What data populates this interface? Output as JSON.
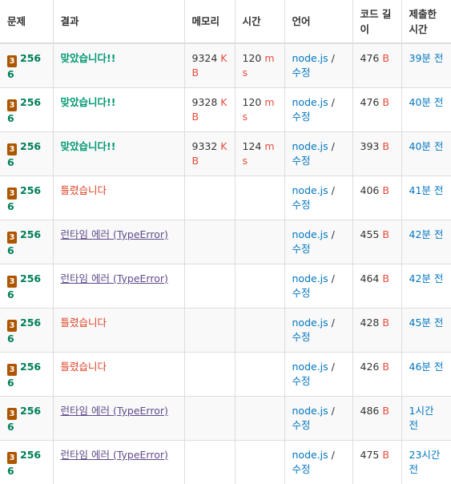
{
  "headers": {
    "problem": "문제",
    "result": "결과",
    "memory": "메모리",
    "time": "시간",
    "language": "언어",
    "code_length": "코드 길이",
    "submitted": "제출한 시간"
  },
  "tier_icon": "3",
  "rows": [
    {
      "problem": "2566",
      "result": "맞았습니다!!",
      "result_type": "ok",
      "memory": "9324",
      "memory_unit": "KB",
      "time": "120",
      "time_unit": "ms",
      "lang": "node.js",
      "sep": " / ",
      "edit": "수정",
      "code_len": "476",
      "len_unit": "B",
      "submitted": "39분 전"
    },
    {
      "problem": "2566",
      "result": "맞았습니다!!",
      "result_type": "ok",
      "memory": "9328",
      "memory_unit": "KB",
      "time": "120",
      "time_unit": "ms",
      "lang": "node.js",
      "sep": " / ",
      "edit": "수정",
      "code_len": "476",
      "len_unit": "B",
      "submitted": "40분 전"
    },
    {
      "problem": "2566",
      "result": "맞았습니다!!",
      "result_type": "ok",
      "memory": "9332",
      "memory_unit": "KB",
      "time": "124",
      "time_unit": "ms",
      "lang": "node.js",
      "sep": " / ",
      "edit": "수정",
      "code_len": "393",
      "len_unit": "B",
      "submitted": "40분 전"
    },
    {
      "problem": "2566",
      "result": "틀렸습니다",
      "result_type": "wrong",
      "memory": "",
      "memory_unit": "",
      "time": "",
      "time_unit": "",
      "lang": "node.js",
      "sep": " / ",
      "edit": "수정",
      "code_len": "406",
      "len_unit": "B",
      "submitted": "41분 전"
    },
    {
      "problem": "2566",
      "result": "런타임 에러 (TypeError)",
      "result_type": "rte",
      "memory": "",
      "memory_unit": "",
      "time": "",
      "time_unit": "",
      "lang": "node.js",
      "sep": " / ",
      "edit": "수정",
      "code_len": "455",
      "len_unit": "B",
      "submitted": "42분 전"
    },
    {
      "problem": "2566",
      "result": "런타임 에러 (TypeError)",
      "result_type": "rte",
      "memory": "",
      "memory_unit": "",
      "time": "",
      "time_unit": "",
      "lang": "node.js",
      "sep": " / ",
      "edit": "수정",
      "code_len": "464",
      "len_unit": "B",
      "submitted": "42분 전"
    },
    {
      "problem": "2566",
      "result": "틀렸습니다",
      "result_type": "wrong",
      "memory": "",
      "memory_unit": "",
      "time": "",
      "time_unit": "",
      "lang": "node.js",
      "sep": " / ",
      "edit": "수정",
      "code_len": "428",
      "len_unit": "B",
      "submitted": "45분 전"
    },
    {
      "problem": "2566",
      "result": "틀렸습니다",
      "result_type": "wrong",
      "memory": "",
      "memory_unit": "",
      "time": "",
      "time_unit": "",
      "lang": "node.js",
      "sep": " / ",
      "edit": "수정",
      "code_len": "426",
      "len_unit": "B",
      "submitted": "46분 전"
    },
    {
      "problem": "2566",
      "result": "런타임 에러 (TypeError)",
      "result_type": "rte",
      "memory": "",
      "memory_unit": "",
      "time": "",
      "time_unit": "",
      "lang": "node.js",
      "sep": " / ",
      "edit": "수정",
      "code_len": "486",
      "len_unit": "B",
      "submitted": "1시간 전"
    },
    {
      "problem": "2566",
      "result": "런타임 에러 (TypeError)",
      "result_type": "rte",
      "memory": "",
      "memory_unit": "",
      "time": "",
      "time_unit": "",
      "lang": "node.js",
      "sep": " / ",
      "edit": "수정",
      "code_len": "475",
      "len_unit": "B",
      "submitted": "23시간 전"
    }
  ],
  "colors": {
    "tier_bronze": "#ad5600",
    "accepted": "#009874",
    "wrong": "#dd4124",
    "runtime_error": "#5f4b8b",
    "unit": "#e74c3c",
    "link": "#0076c0"
  }
}
